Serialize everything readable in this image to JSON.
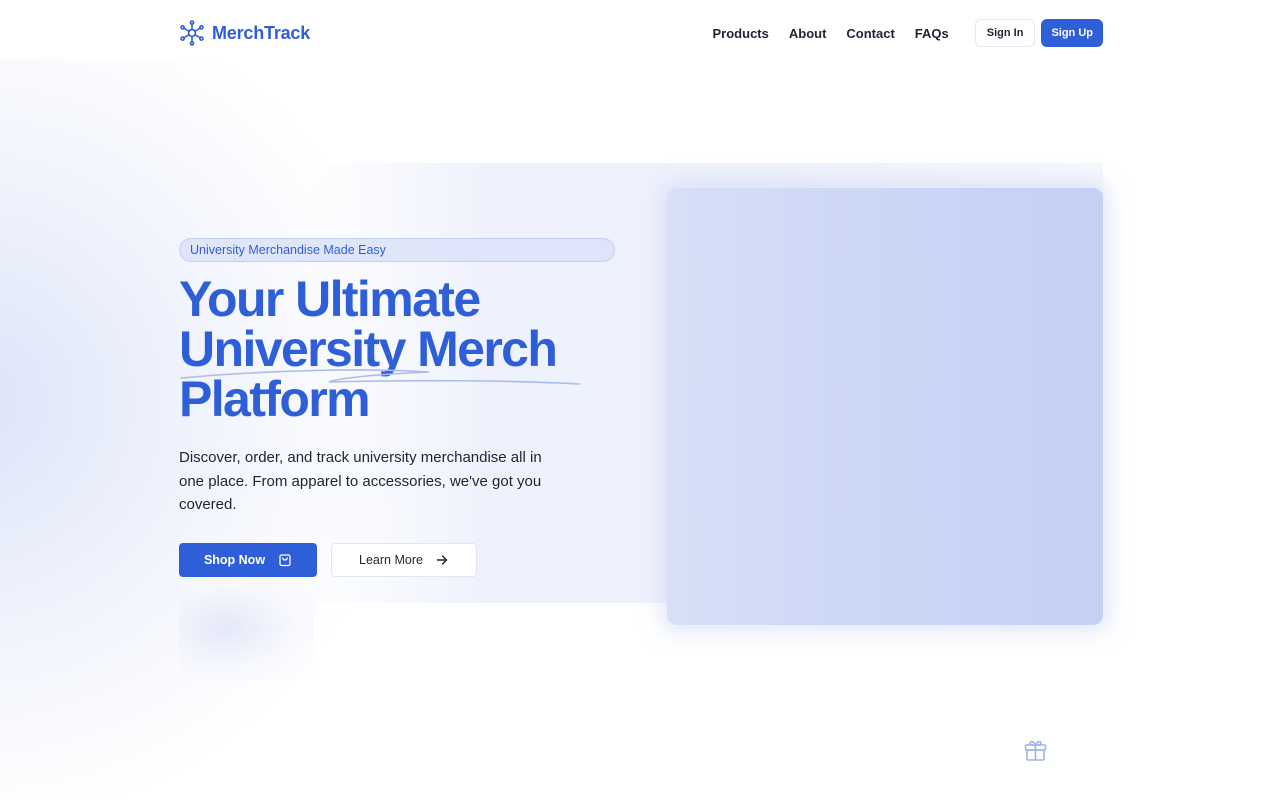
{
  "brand": {
    "name": "MerchTrack",
    "accent_color": "#2f5fd8",
    "logo_icon": "network-hub-icon"
  },
  "nav": {
    "links": [
      {
        "label": "Products"
      },
      {
        "label": "About"
      },
      {
        "label": "Contact"
      },
      {
        "label": "FAQs"
      }
    ],
    "sign_in_label": "Sign In",
    "sign_up_label": "Sign Up"
  },
  "hero": {
    "badge": "University Merchandise Made Easy",
    "headline_lines": [
      "Your Ultimate",
      "University Merch",
      "Platform"
    ],
    "description": "Discover, order, and track university merchandise all in one place. From apparel to accessories, we've got you covered.",
    "primary_button": {
      "label": "Shop Now",
      "icon": "shopping-bag-icon"
    },
    "secondary_button": {
      "label": "Learn More",
      "icon": "arrow-right-icon"
    }
  },
  "decorations": {
    "floating_icon": "gift-icon"
  }
}
